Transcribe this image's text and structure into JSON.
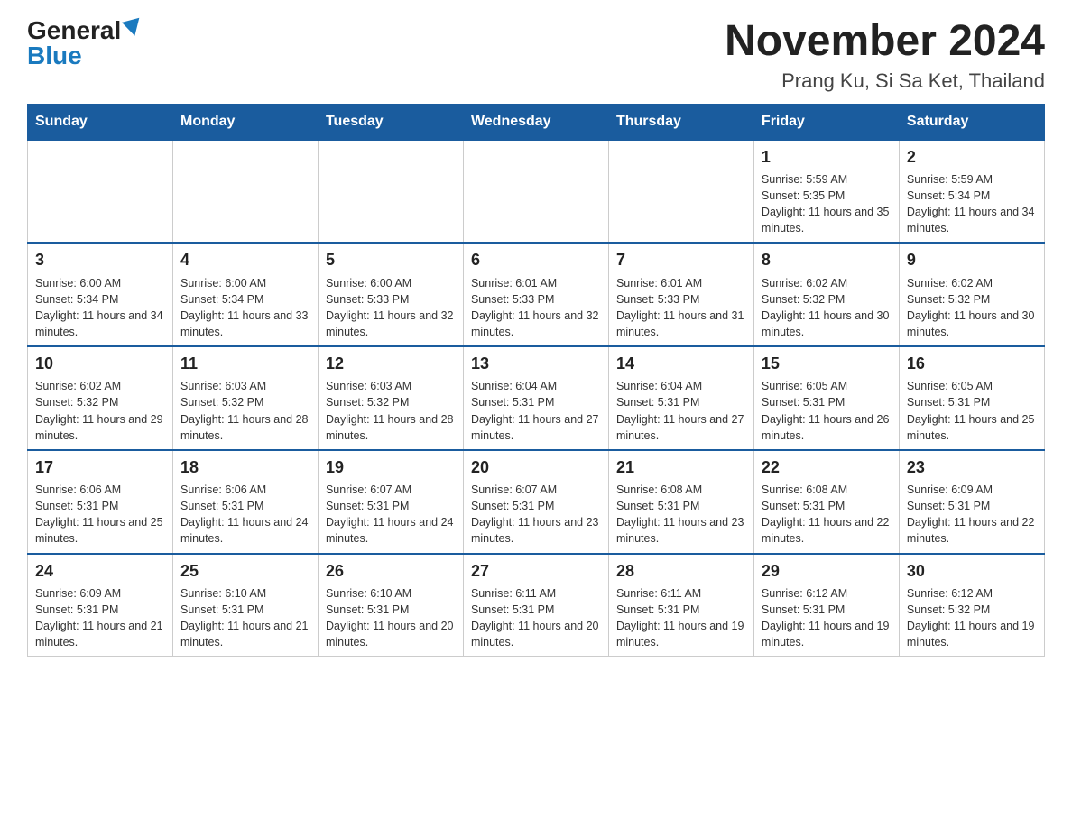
{
  "header": {
    "logo_general": "General",
    "logo_blue": "Blue",
    "month_title": "November 2024",
    "location": "Prang Ku, Si Sa Ket, Thailand"
  },
  "weekdays": [
    "Sunday",
    "Monday",
    "Tuesday",
    "Wednesday",
    "Thursday",
    "Friday",
    "Saturday"
  ],
  "weeks": [
    [
      {
        "day": "",
        "info": ""
      },
      {
        "day": "",
        "info": ""
      },
      {
        "day": "",
        "info": ""
      },
      {
        "day": "",
        "info": ""
      },
      {
        "day": "",
        "info": ""
      },
      {
        "day": "1",
        "info": "Sunrise: 5:59 AM\nSunset: 5:35 PM\nDaylight: 11 hours and 35 minutes."
      },
      {
        "day": "2",
        "info": "Sunrise: 5:59 AM\nSunset: 5:34 PM\nDaylight: 11 hours and 34 minutes."
      }
    ],
    [
      {
        "day": "3",
        "info": "Sunrise: 6:00 AM\nSunset: 5:34 PM\nDaylight: 11 hours and 34 minutes."
      },
      {
        "day": "4",
        "info": "Sunrise: 6:00 AM\nSunset: 5:34 PM\nDaylight: 11 hours and 33 minutes."
      },
      {
        "day": "5",
        "info": "Sunrise: 6:00 AM\nSunset: 5:33 PM\nDaylight: 11 hours and 32 minutes."
      },
      {
        "day": "6",
        "info": "Sunrise: 6:01 AM\nSunset: 5:33 PM\nDaylight: 11 hours and 32 minutes."
      },
      {
        "day": "7",
        "info": "Sunrise: 6:01 AM\nSunset: 5:33 PM\nDaylight: 11 hours and 31 minutes."
      },
      {
        "day": "8",
        "info": "Sunrise: 6:02 AM\nSunset: 5:32 PM\nDaylight: 11 hours and 30 minutes."
      },
      {
        "day": "9",
        "info": "Sunrise: 6:02 AM\nSunset: 5:32 PM\nDaylight: 11 hours and 30 minutes."
      }
    ],
    [
      {
        "day": "10",
        "info": "Sunrise: 6:02 AM\nSunset: 5:32 PM\nDaylight: 11 hours and 29 minutes."
      },
      {
        "day": "11",
        "info": "Sunrise: 6:03 AM\nSunset: 5:32 PM\nDaylight: 11 hours and 28 minutes."
      },
      {
        "day": "12",
        "info": "Sunrise: 6:03 AM\nSunset: 5:32 PM\nDaylight: 11 hours and 28 minutes."
      },
      {
        "day": "13",
        "info": "Sunrise: 6:04 AM\nSunset: 5:31 PM\nDaylight: 11 hours and 27 minutes."
      },
      {
        "day": "14",
        "info": "Sunrise: 6:04 AM\nSunset: 5:31 PM\nDaylight: 11 hours and 27 minutes."
      },
      {
        "day": "15",
        "info": "Sunrise: 6:05 AM\nSunset: 5:31 PM\nDaylight: 11 hours and 26 minutes."
      },
      {
        "day": "16",
        "info": "Sunrise: 6:05 AM\nSunset: 5:31 PM\nDaylight: 11 hours and 25 minutes."
      }
    ],
    [
      {
        "day": "17",
        "info": "Sunrise: 6:06 AM\nSunset: 5:31 PM\nDaylight: 11 hours and 25 minutes."
      },
      {
        "day": "18",
        "info": "Sunrise: 6:06 AM\nSunset: 5:31 PM\nDaylight: 11 hours and 24 minutes."
      },
      {
        "day": "19",
        "info": "Sunrise: 6:07 AM\nSunset: 5:31 PM\nDaylight: 11 hours and 24 minutes."
      },
      {
        "day": "20",
        "info": "Sunrise: 6:07 AM\nSunset: 5:31 PM\nDaylight: 11 hours and 23 minutes."
      },
      {
        "day": "21",
        "info": "Sunrise: 6:08 AM\nSunset: 5:31 PM\nDaylight: 11 hours and 23 minutes."
      },
      {
        "day": "22",
        "info": "Sunrise: 6:08 AM\nSunset: 5:31 PM\nDaylight: 11 hours and 22 minutes."
      },
      {
        "day": "23",
        "info": "Sunrise: 6:09 AM\nSunset: 5:31 PM\nDaylight: 11 hours and 22 minutes."
      }
    ],
    [
      {
        "day": "24",
        "info": "Sunrise: 6:09 AM\nSunset: 5:31 PM\nDaylight: 11 hours and 21 minutes."
      },
      {
        "day": "25",
        "info": "Sunrise: 6:10 AM\nSunset: 5:31 PM\nDaylight: 11 hours and 21 minutes."
      },
      {
        "day": "26",
        "info": "Sunrise: 6:10 AM\nSunset: 5:31 PM\nDaylight: 11 hours and 20 minutes."
      },
      {
        "day": "27",
        "info": "Sunrise: 6:11 AM\nSunset: 5:31 PM\nDaylight: 11 hours and 20 minutes."
      },
      {
        "day": "28",
        "info": "Sunrise: 6:11 AM\nSunset: 5:31 PM\nDaylight: 11 hours and 19 minutes."
      },
      {
        "day": "29",
        "info": "Sunrise: 6:12 AM\nSunset: 5:31 PM\nDaylight: 11 hours and 19 minutes."
      },
      {
        "day": "30",
        "info": "Sunrise: 6:12 AM\nSunset: 5:32 PM\nDaylight: 11 hours and 19 minutes."
      }
    ]
  ]
}
